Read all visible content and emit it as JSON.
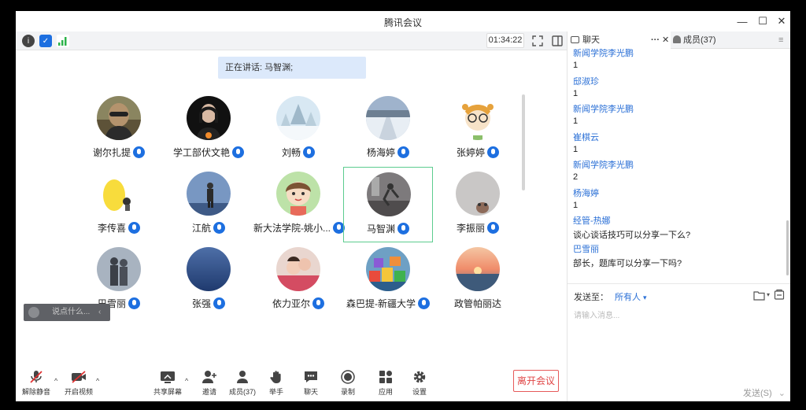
{
  "window": {
    "title": "腾讯会议"
  },
  "top_toolbar": {
    "timer": "01:34:22"
  },
  "speaking": {
    "text": "正在讲话: 马智渊;"
  },
  "participants": [
    {
      "name": "谢尔扎提",
      "mic": true,
      "avatar": "photo-man-sunglasses"
    },
    {
      "name": "学工部伏文艳",
      "mic": true,
      "avatar": "photo-woman-dark"
    },
    {
      "name": "刘畅",
      "mic": true,
      "avatar": "snow-tree"
    },
    {
      "name": "杨海婷",
      "mic": true,
      "avatar": "snow-road"
    },
    {
      "name": "张婷婷",
      "mic": true,
      "avatar": "cartoon-girl-glasses"
    },
    {
      "name": "李传喜",
      "mic": true,
      "avatar": "yellow-cartoon"
    },
    {
      "name": "江航",
      "mic": true,
      "avatar": "person-standing"
    },
    {
      "name": "新大法学院-姚小...",
      "mic": true,
      "avatar": "cartoon-girl-green"
    },
    {
      "name": "马智渊",
      "mic": true,
      "avatar": "dancer-blur",
      "active": true
    },
    {
      "name": "李振丽",
      "mic": true,
      "avatar": "animal-gray"
    },
    {
      "name": "巴雪丽",
      "mic": true,
      "avatar": "couple-silhouette"
    },
    {
      "name": "张强",
      "mic": true,
      "avatar": "blue-plain"
    },
    {
      "name": "依力亚尔",
      "mic": true,
      "avatar": "baby-photo"
    },
    {
      "name": "森巴提-新疆大学",
      "mic": true,
      "avatar": "toys-colorful"
    },
    {
      "name": "政管帕丽达",
      "mic": false,
      "avatar": "sunset"
    }
  ],
  "float_chat": {
    "placeholder": "说点什么..."
  },
  "bottom_bar": {
    "mute": "解除静音",
    "video": "开启视频",
    "share": "共享屏幕",
    "invite": "邀请",
    "members": "成员(37)",
    "raise_hand": "举手",
    "chat": "聊天",
    "record": "录制",
    "apps": "应用",
    "settings": "设置",
    "leave": "离开会议"
  },
  "panel": {
    "tab_chat": "聊天",
    "tab_members": "成员(37)",
    "messages": [
      {
        "sender": "新闻学院李光鹏",
        "text": "1"
      },
      {
        "sender": "邸淑珍",
        "text": "1"
      },
      {
        "sender": "新闻学院李光鹏",
        "text": "1"
      },
      {
        "sender": "崔棋云",
        "text": "1"
      },
      {
        "sender": "新闻学院李光鹏",
        "text": "2"
      },
      {
        "sender": "杨海婷",
        "text": "1"
      },
      {
        "sender": "经管-热娜",
        "text": "谈心谈话技巧可以分享一下么?"
      },
      {
        "sender": "巴雪丽",
        "text": "部长，题库可以分享一下吗?"
      }
    ],
    "send_to_label": "发送至：",
    "send_to_value": "所有人",
    "input_placeholder": "请输入消息...",
    "send_button": "发送(S)"
  },
  "colors": {
    "accent": "#1d6fe0",
    "active_border": "#5ccc8f",
    "leave_red": "#e04545"
  }
}
